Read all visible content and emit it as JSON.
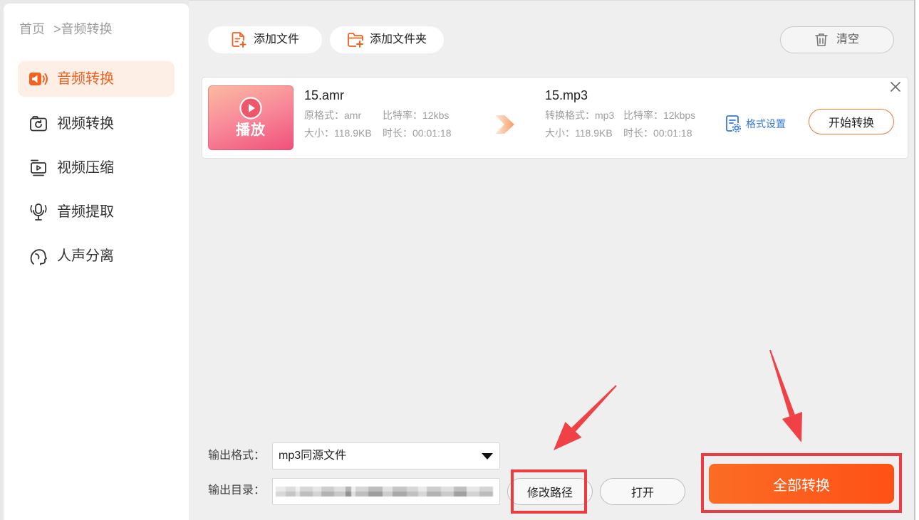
{
  "colors": {
    "accent": "#f4601f",
    "accent_light": "#fdefe6",
    "highlight": "#ee3b42",
    "link": "#3478e0"
  },
  "breadcrumb": {
    "home": "首页",
    "current": ">音频转换"
  },
  "sidebar": {
    "items": [
      {
        "label": "音频转换",
        "icon": "audio-convert-icon",
        "active": true
      },
      {
        "label": "视频转换",
        "icon": "video-convert-icon",
        "active": false
      },
      {
        "label": "视频压缩",
        "icon": "video-compress-icon",
        "active": false
      },
      {
        "label": "音频提取",
        "icon": "audio-extract-icon",
        "active": false
      },
      {
        "label": "人声分离",
        "icon": "vocal-separation-icon",
        "active": false
      }
    ]
  },
  "toolbar": {
    "add_file": {
      "label": "添加文件",
      "icon": "add-file-icon"
    },
    "add_folder": {
      "label": "添加文件夹",
      "icon": "add-folder-icon"
    },
    "clear": {
      "label": "清空",
      "icon": "trash-icon"
    }
  },
  "files": [
    {
      "thumbnail": {
        "label": "播放",
        "icon": "play-icon"
      },
      "source": {
        "name": "15.amr",
        "format": "原格式：amr",
        "bitrate": "比特率：12kbs",
        "size": "大小：118.9KB",
        "duration": "时长：00:01:18"
      },
      "arrow_icon": "convert-arrow-icon",
      "target": {
        "name": "15.mp3",
        "format": "转换格式：mp3",
        "bitrate": "比特率：12kbps",
        "size": "大小：118.9KB",
        "duration": "时长：00:01:18"
      },
      "format_settings": {
        "label": "格式设置",
        "icon": "format-settings-icon"
      },
      "start_button": "开始转换",
      "remove_icon": "close-icon"
    }
  ],
  "output": {
    "format_label": "输出格式：",
    "format_value": "mp3同源文件",
    "dir_label": "输出目录：",
    "change_path_button": "修改路径",
    "open_button": "打开"
  },
  "convert_all_button": "全部转换"
}
